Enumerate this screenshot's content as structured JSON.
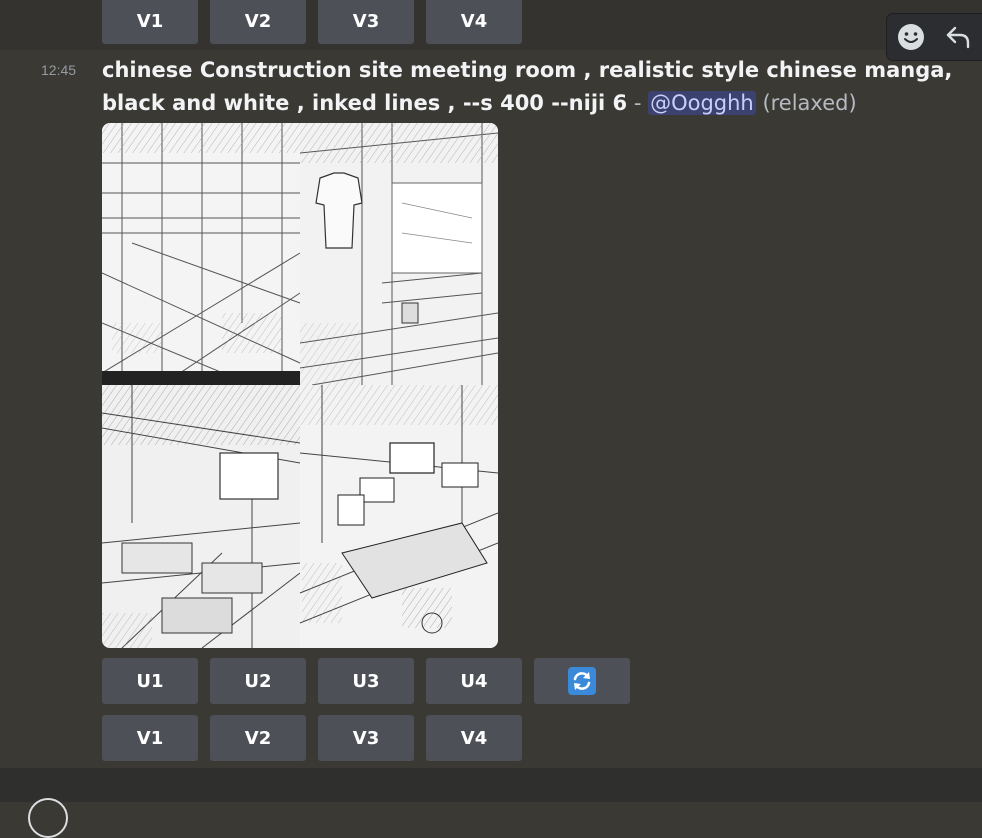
{
  "top_buttons": [
    "V1",
    "V2",
    "V3",
    "V4"
  ],
  "timestamp": "12:45",
  "message": {
    "prompt": "chinese Construction site meeting room ,   realistic style chinese manga, black and white , inked lines , --s 400 --niji 6",
    "separator": " - ",
    "mention": "@Oogghh",
    "mode": "(relaxed)"
  },
  "image": {
    "panels": [
      {
        "icon": "manga-construction-hall-image"
      },
      {
        "icon": "manga-workshop-shirt-image"
      },
      {
        "icon": "manga-meeting-room-image"
      },
      {
        "icon": "manga-office-desks-image"
      }
    ]
  },
  "upscale_buttons": [
    "U1",
    "U2",
    "U3",
    "U4"
  ],
  "reroll_icon": "refresh-icon",
  "variation_buttons": [
    "V1",
    "V2",
    "V3",
    "V4"
  ],
  "toolbar": {
    "emoji_icon": "emoji-smile-icon",
    "reply_icon": "reply-arrow-icon"
  },
  "colors": {
    "background": "#3b3934",
    "button": "#4e5058",
    "mention_bg": "#3c4270",
    "reroll": "#3b8ad9"
  }
}
